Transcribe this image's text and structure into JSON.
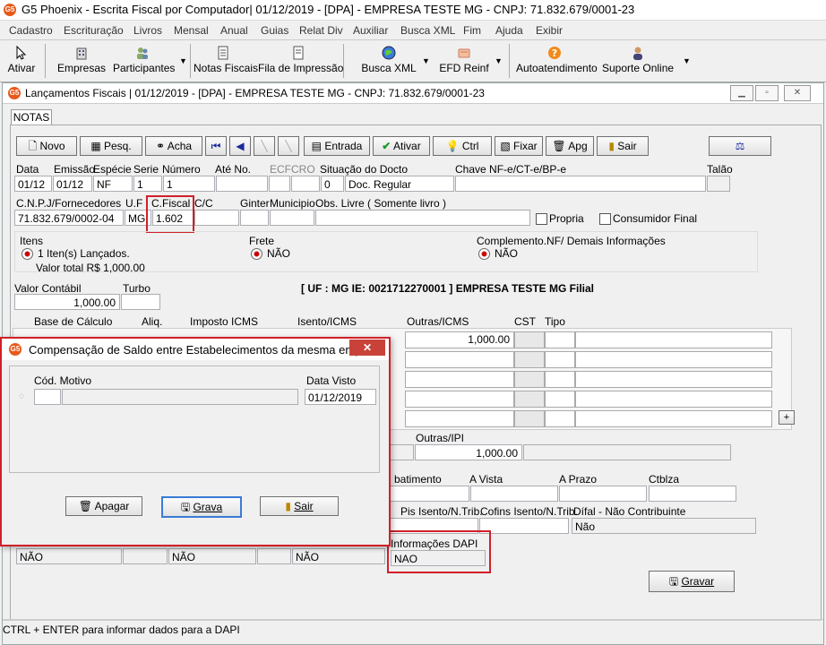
{
  "app": {
    "title": "G5 Phoenix - Escrita Fiscal por Computador|  01/12/2019 - [DPA] - EMPRESA TESTE MG - CNPJ: 71.832.679/0001-23",
    "logo": "G5"
  },
  "menu": [
    "Cadastro",
    "Escrituração",
    "Livros",
    "Mensal",
    "Anual",
    "Guias",
    "Relat Div",
    "Auxiliar",
    "Busca XML",
    "Fim",
    "Ajuda",
    "Exibir"
  ],
  "toolbar": {
    "ativar": "Ativar",
    "empresas": "Empresas",
    "participantes": "Participantes",
    "notas_fiscais": "Notas Fiscais",
    "fila_impressao": "Fila de Impressão",
    "busca_xml": "Busca XML",
    "efd_reinf": "EFD Reinf",
    "autoatendimento": "Autoatendimento",
    "suporte_online": "Suporte Online"
  },
  "window": {
    "title": "Lançamentos Fiscais |  01/12/2019 - [DPA] - EMPRESA TESTE MG - CNPJ: 71.832.679/0001-23",
    "tab": "NOTAS"
  },
  "actions": {
    "novo": "Novo",
    "pesq": "Pesq.",
    "acha": "Acha",
    "entrada": "Entrada",
    "ativar": "Ativar",
    "ctrl": "Ctrl",
    "fixar": "Fixar",
    "apg": "Apg",
    "sair": "Sair"
  },
  "header_labels": {
    "data": "Data",
    "emissao": "Emissão",
    "especie": "Espécie",
    "serie": "Serie",
    "numero": "Número",
    "ate_no": "Até No.",
    "ecf": "ECF",
    "cro": "CRO",
    "situacao": "Situação do Docto",
    "chave": "Chave NF-e/CT-e/BP-e",
    "talao": "Talão"
  },
  "header_values": {
    "data": "01/12",
    "emissao": "01/12",
    "especie": "NF",
    "serie": "1",
    "numero": "1",
    "situacao_cod": "0",
    "situacao": "Doc. Regular"
  },
  "row2_labels": {
    "cnpj": "C.N.P.J/Fornecedores",
    "uf": "U.F",
    "cfiscal": "C.Fiscal",
    "cc": "C/C",
    "ginter": "Ginter",
    "municipio": "Municipio",
    "obs": "Obs. Livre ( Somente livro )",
    "propria": "Propria",
    "consumidor": "Consumidor Final"
  },
  "row2_values": {
    "cnpj": "71.832.679/0002-04",
    "uf": "MG",
    "cfiscal": "1.602"
  },
  "info": {
    "itens_label": "Itens",
    "itens_value": "1 Iten(s) Lançados.",
    "valor_total": "Valor total R$ 1,000.00",
    "frete_label": "Frete",
    "frete_value": "NÃO",
    "compl_label": "Complemento.NF/ Demais Informações",
    "compl_value": "NÃO"
  },
  "valor": {
    "contabil_label": "Valor Contábil",
    "contabil_value": "1,000.00",
    "turbo_label": "Turbo",
    "ie_banner": "[ UF : MG IE: 0021712270001 ] EMPRESA TESTE MG Filial"
  },
  "icms_grid": {
    "headers": [
      "Base de Cálculo",
      "Aliq.",
      "Imposto ICMS",
      "Isento/ICMS",
      "Outras/ICMS",
      "CST",
      "Tipo"
    ],
    "outras_value": "1,000.00",
    "add": "+"
  },
  "ipi": {
    "outras_label": "Outras/IPI",
    "outras_value": "1,000.00"
  },
  "pagto": {
    "abatimento": "batimento",
    "a_vista": "A Vista",
    "a_prazo": "A Prazo",
    "ctblza": "Ctblza"
  },
  "pis": {
    "pis_isento": "Pis Isento/N.Trib.",
    "cofins_isento": "Cofins Isento/N.Trib.",
    "difal": "Dífal - Não Contribuinte",
    "difal_value": "Não"
  },
  "dapi": {
    "label": "Informações DAPI",
    "value": "NAO"
  },
  "bottom_row": [
    "NÃO",
    "NÃO",
    "NÃO"
  ],
  "gravar": "Gravar",
  "dialog": {
    "title": "Compensação de Saldo entre Estabelecimentos da mesma empr...",
    "cod_motivo": "Cód. Motivo",
    "data_visto": "Data Visto",
    "data_visto_value": "01/12/2019",
    "apagar": "Apagar",
    "grava": "Grava",
    "sair": "Sair",
    "close": "✕"
  },
  "status": "CTRL + ENTER para informar dados para a DAPI"
}
